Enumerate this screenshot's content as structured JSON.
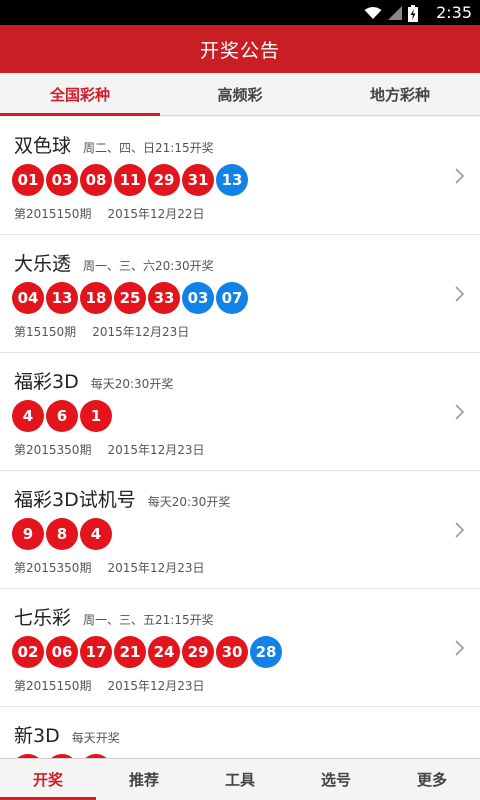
{
  "status": {
    "time": "2:35"
  },
  "header": {
    "title": "开奖公告"
  },
  "tabs": [
    {
      "label": "全国彩种",
      "active": true
    },
    {
      "label": "高频彩",
      "active": false
    },
    {
      "label": "地方彩种",
      "active": false
    }
  ],
  "lotteries": [
    {
      "name": "双色球",
      "schedule": "周二、四、日21:15开奖",
      "balls": [
        {
          "n": "01",
          "c": "red"
        },
        {
          "n": "03",
          "c": "red"
        },
        {
          "n": "08",
          "c": "red"
        },
        {
          "n": "11",
          "c": "red"
        },
        {
          "n": "29",
          "c": "red"
        },
        {
          "n": "31",
          "c": "red"
        },
        {
          "n": "13",
          "c": "blue"
        }
      ],
      "issue": "第2015150期",
      "date": "2015年12月22日"
    },
    {
      "name": "大乐透",
      "schedule": "周一、三、六20:30开奖",
      "balls": [
        {
          "n": "04",
          "c": "red"
        },
        {
          "n": "13",
          "c": "red"
        },
        {
          "n": "18",
          "c": "red"
        },
        {
          "n": "25",
          "c": "red"
        },
        {
          "n": "33",
          "c": "red"
        },
        {
          "n": "03",
          "c": "blue"
        },
        {
          "n": "07",
          "c": "blue"
        }
      ],
      "issue": "第15150期",
      "date": "2015年12月23日"
    },
    {
      "name": "福彩3D",
      "schedule": "每天20:30开奖",
      "balls": [
        {
          "n": "4",
          "c": "red"
        },
        {
          "n": "6",
          "c": "red"
        },
        {
          "n": "1",
          "c": "red"
        }
      ],
      "issue": "第2015350期",
      "date": "2015年12月23日"
    },
    {
      "name": "福彩3D试机号",
      "schedule": "每天20:30开奖",
      "balls": [
        {
          "n": "9",
          "c": "red"
        },
        {
          "n": "8",
          "c": "red"
        },
        {
          "n": "4",
          "c": "red"
        }
      ],
      "issue": "第2015350期",
      "date": "2015年12月23日"
    },
    {
      "name": "七乐彩",
      "schedule": "周一、三、五21:15开奖",
      "balls": [
        {
          "n": "02",
          "c": "red"
        },
        {
          "n": "06",
          "c": "red"
        },
        {
          "n": "17",
          "c": "red"
        },
        {
          "n": "21",
          "c": "red"
        },
        {
          "n": "24",
          "c": "red"
        },
        {
          "n": "29",
          "c": "red"
        },
        {
          "n": "30",
          "c": "red"
        },
        {
          "n": "28",
          "c": "blue"
        }
      ],
      "issue": "第2015150期",
      "date": "2015年12月23日"
    },
    {
      "name": "新3D",
      "schedule": "每天开奖",
      "balls": [
        {
          "n": "",
          "c": "red"
        },
        {
          "n": "",
          "c": "red"
        },
        {
          "n": "",
          "c": "red"
        }
      ],
      "issue": "",
      "date": ""
    }
  ],
  "bottom_nav": [
    {
      "label": "开奖",
      "active": true
    },
    {
      "label": "推荐",
      "active": false
    },
    {
      "label": "工具",
      "active": false
    },
    {
      "label": "选号",
      "active": false
    },
    {
      "label": "更多",
      "active": false
    }
  ],
  "colors": {
    "brand": "#c81e24",
    "red_ball": "#e3141b",
    "blue_ball": "#1281e8"
  }
}
